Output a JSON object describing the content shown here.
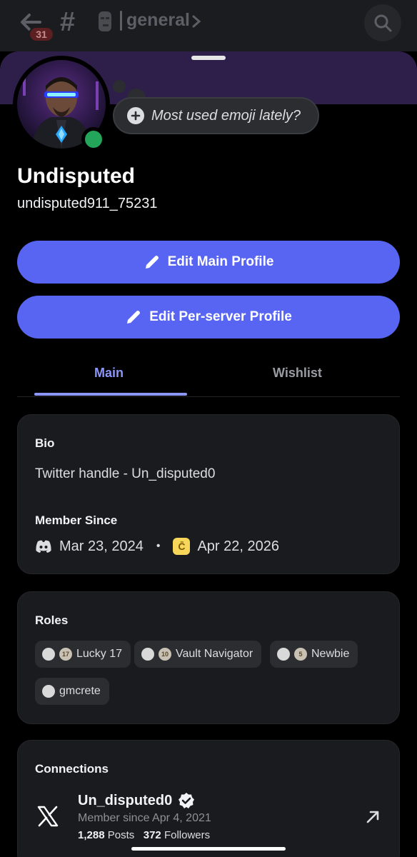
{
  "topbar": {
    "unread_badge": "31",
    "channel_name": "general"
  },
  "status": {
    "bubble_text": "Most used emoji lately?"
  },
  "profile": {
    "display_name": "Undisputed",
    "username": "undisputed911_75231"
  },
  "buttons": {
    "edit_main": "Edit Main Profile",
    "edit_server": "Edit Per-server Profile"
  },
  "tabs": {
    "main": "Main",
    "wishlist": "Wishlist",
    "active": "Main"
  },
  "bio": {
    "label": "Bio",
    "text": "Twitter handle - Un_disputed0"
  },
  "member_since": {
    "label": "Member Since",
    "discord_date": "Mar 23, 2024",
    "separator": "•",
    "server_date": "Apr 22, 2026",
    "server_icon_letter": "C̄"
  },
  "roles": {
    "label": "Roles",
    "items": [
      {
        "badge": "17",
        "name": "Lucky 17"
      },
      {
        "badge": "10",
        "name": "Vault Navigator"
      },
      {
        "badge": "5",
        "name": "Newbie"
      },
      {
        "badge": "",
        "name": "gmcrete"
      }
    ]
  },
  "connections": {
    "label": "Connections",
    "account_name": "Un_disputed0",
    "member_since": "Member since Apr 4, 2021",
    "posts_count": "1,288",
    "posts_label": "Posts",
    "followers_count": "372",
    "followers_label": "Followers"
  },
  "colors": {
    "accent": "#5865f2",
    "tab_active": "#8b96f8",
    "online": "#23a55a",
    "banner": "#2e1f4a"
  }
}
